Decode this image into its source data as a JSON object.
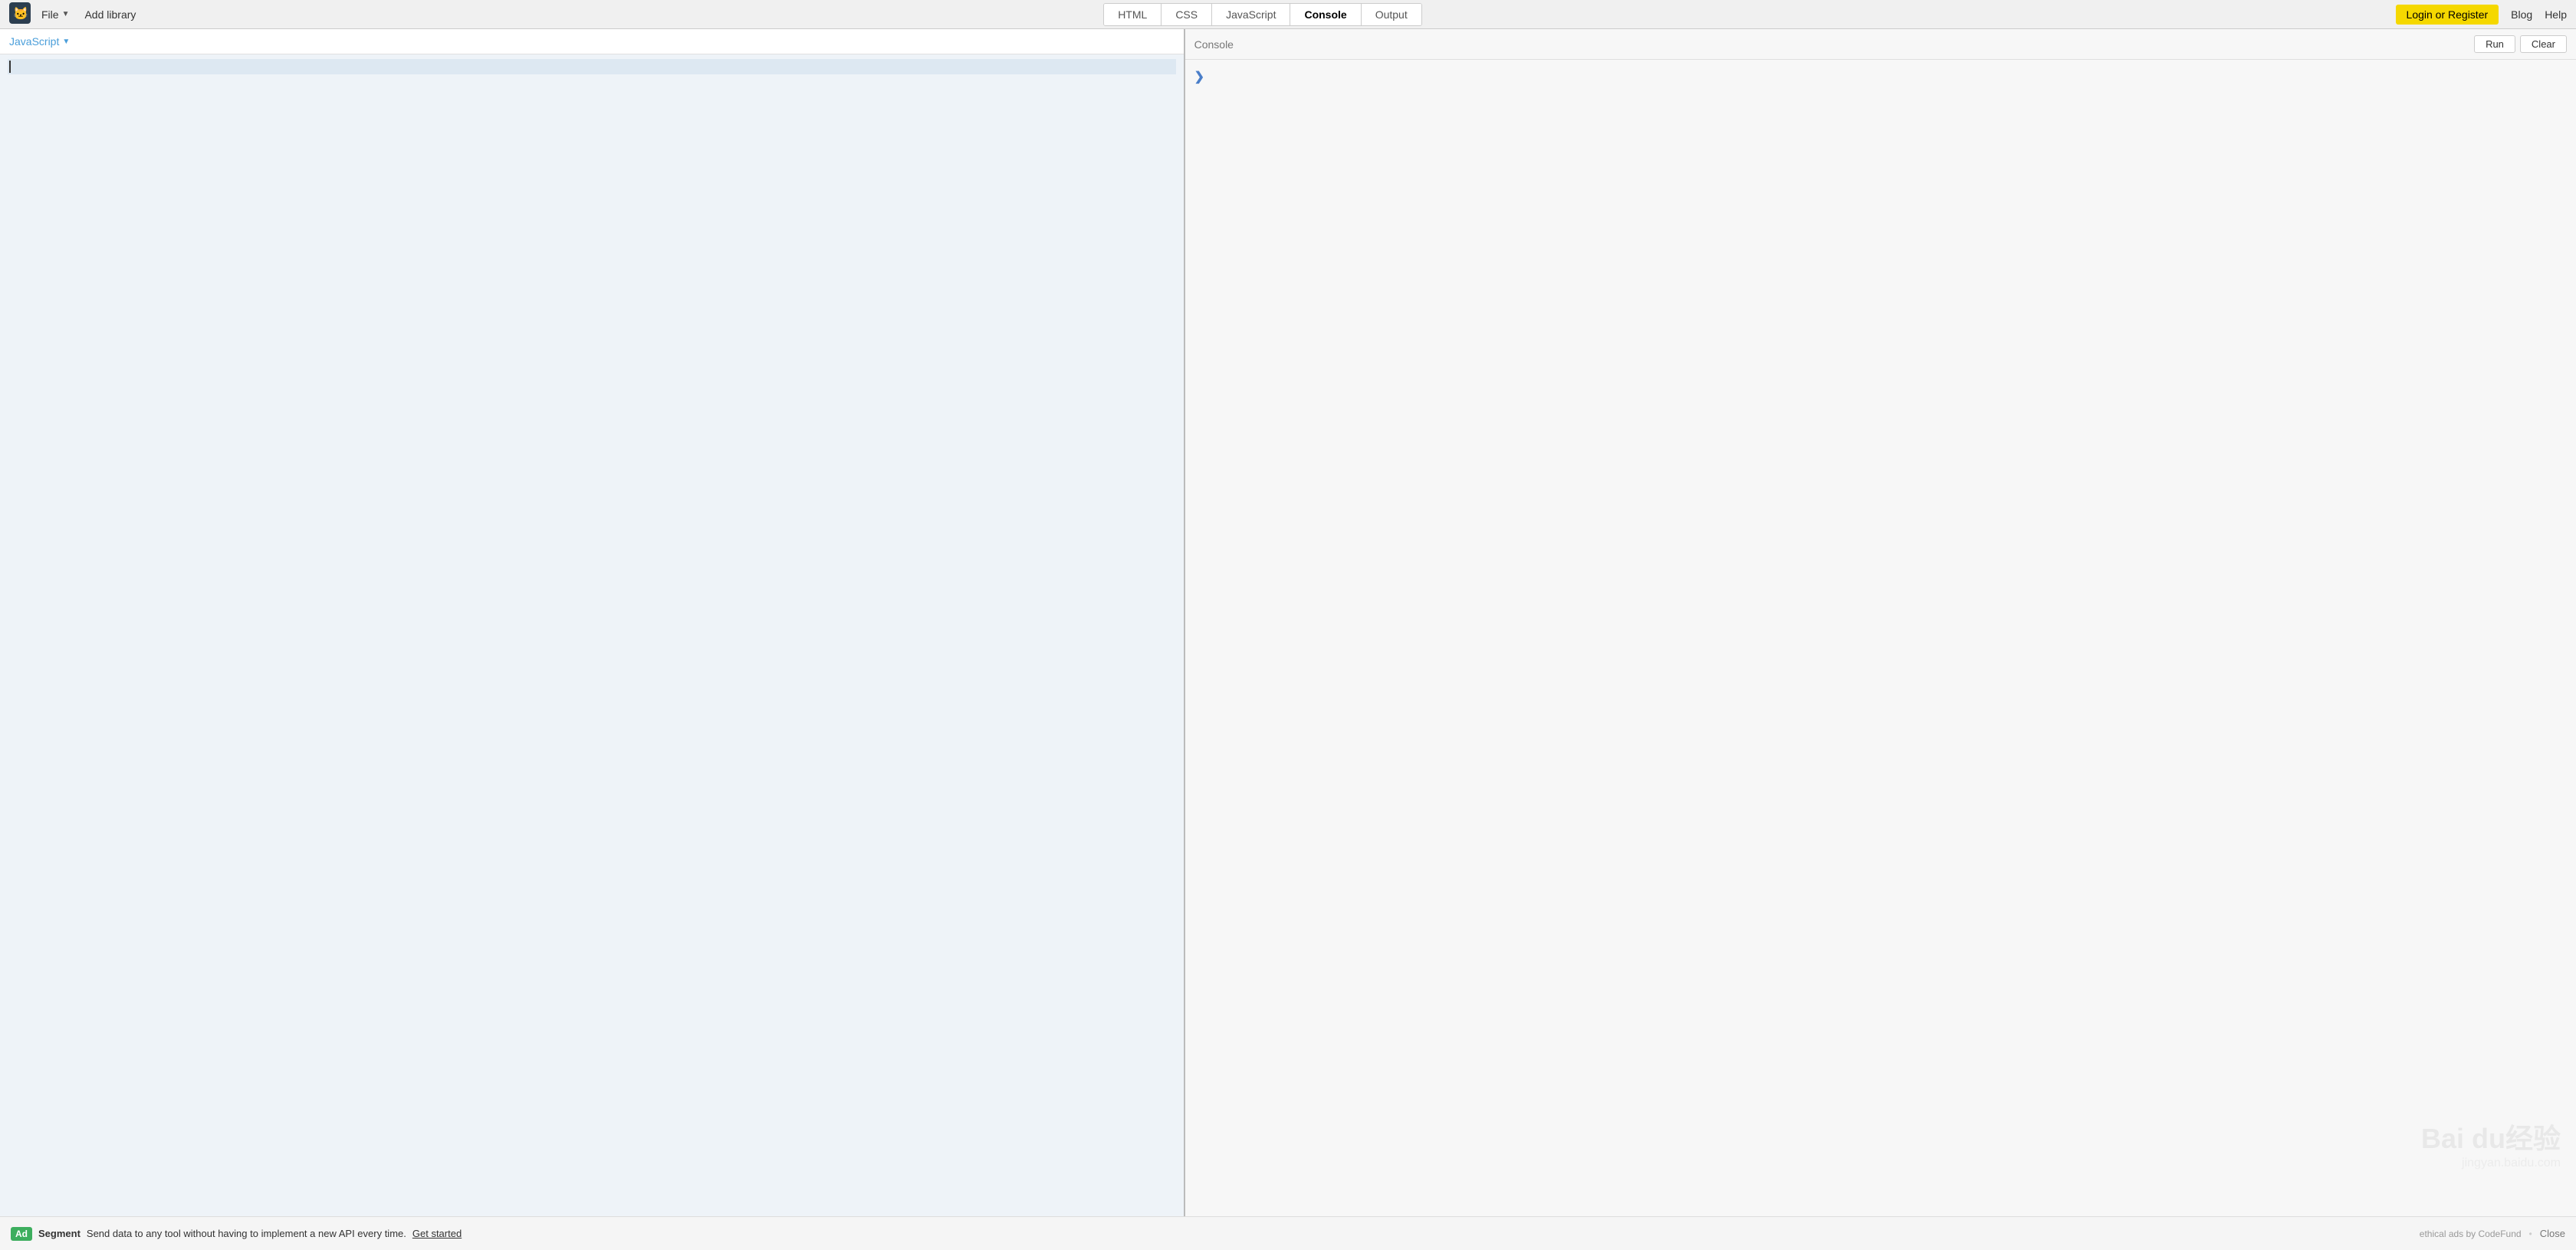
{
  "topNav": {
    "file_label": "File",
    "add_library_label": "Add library",
    "tabs": [
      {
        "id": "html",
        "label": "HTML",
        "active": false
      },
      {
        "id": "css",
        "label": "CSS",
        "active": false
      },
      {
        "id": "javascript",
        "label": "JavaScript",
        "active": false
      },
      {
        "id": "console",
        "label": "Console",
        "active": true
      },
      {
        "id": "output",
        "label": "Output",
        "active": false
      }
    ],
    "login_label": "Login or Register",
    "blog_label": "Blog",
    "help_label": "Help"
  },
  "editor": {
    "language": "JavaScript",
    "dropdown_arrow": "▼"
  },
  "console": {
    "title": "Console",
    "run_label": "Run",
    "clear_label": "Clear",
    "chevron": "❯"
  },
  "adBar": {
    "badge": "Ad",
    "company": "Segment",
    "text": "Send data to any tool without having to implement a new API every time.",
    "link_label": "Get started",
    "attribution": "ethical ads by CodeFund",
    "close_label": "Close"
  },
  "watermark": {
    "line1": "Bai du经验",
    "line2": "jingyan.baidu.com"
  }
}
